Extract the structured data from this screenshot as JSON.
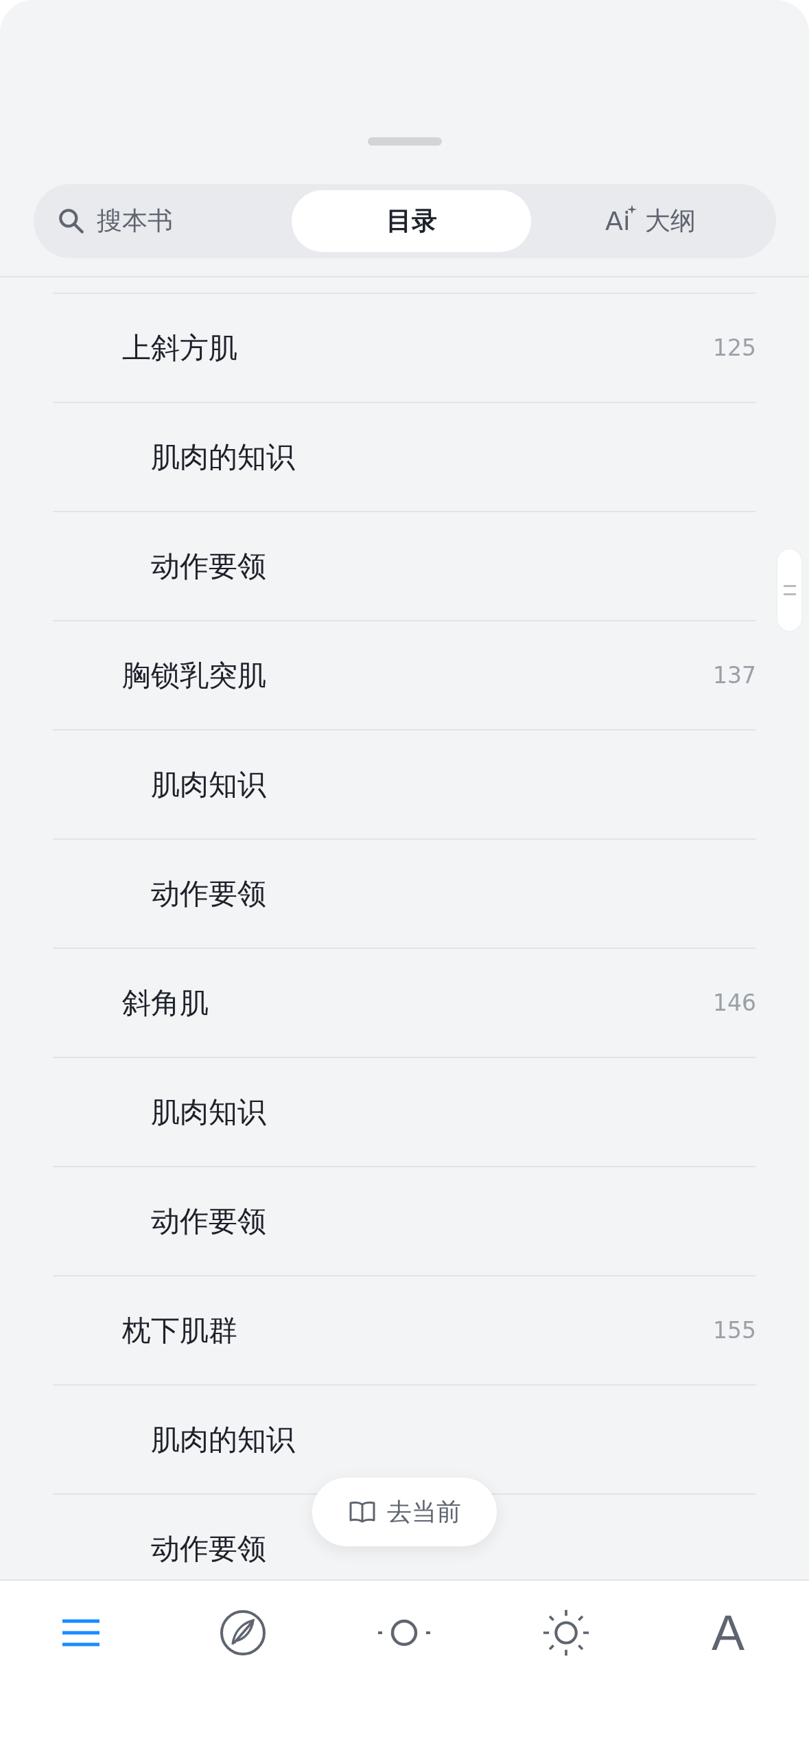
{
  "tabs": [
    {
      "kind": "search",
      "label": "搜本书",
      "selected": false
    },
    {
      "kind": "plain",
      "label": "目录",
      "selected": true
    },
    {
      "kind": "ai",
      "badge": "Ai",
      "label": "大纲",
      "selected": false
    }
  ],
  "toc": [
    {
      "title": "上斜方肌",
      "page": "125",
      "children": [
        {
          "title": "肌肉的知识"
        },
        {
          "title": "动作要领"
        }
      ]
    },
    {
      "title": "胸锁乳突肌",
      "page": "137",
      "children": [
        {
          "title": "肌肉知识"
        },
        {
          "title": "动作要领"
        }
      ]
    },
    {
      "title": "斜角肌",
      "page": "146",
      "children": [
        {
          "title": "肌肉知识"
        },
        {
          "title": "动作要领"
        }
      ]
    },
    {
      "title": "枕下肌群",
      "page": "155",
      "children": [
        {
          "title": "肌肉的知识"
        },
        {
          "title": "动作要领"
        }
      ]
    }
  ],
  "current_button": {
    "label": "去当前"
  },
  "nav": [
    {
      "kind": "menu",
      "selected": true
    },
    {
      "kind": "compass",
      "selected": false
    },
    {
      "kind": "circle",
      "selected": false
    },
    {
      "kind": "sun",
      "selected": false
    },
    {
      "kind": "font",
      "label": "A",
      "selected": false
    }
  ]
}
